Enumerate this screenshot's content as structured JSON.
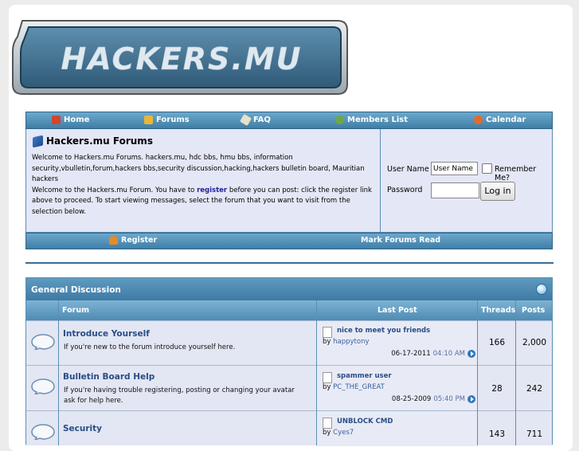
{
  "logo": {
    "text": "HACKERS.MU"
  },
  "nav": [
    {
      "label": "Home",
      "icon": "home-icon"
    },
    {
      "label": "Forums",
      "icon": "forums-icon"
    },
    {
      "label": "FAQ",
      "icon": "faq-icon"
    },
    {
      "label": "Members List",
      "icon": "members-icon"
    },
    {
      "label": "Calendar",
      "icon": "calendar-icon"
    }
  ],
  "welcome": {
    "title": "Hackers.mu Forums",
    "desc_1": "Welcome to Hackers.mu Forums. hackers.mu, hdc bbs, hmu bbs, information security,vbulletin,forum,hackers bbs,security discussion,hacking,hackers bulletin board, Mauritian hackers",
    "desc_2_pre": "Welcome to the Hackers.mu Forum. You have to ",
    "desc_2_link": "register",
    "desc_2_post": " before you can post: click the register link above to proceed. To start viewing messages, select the forum that you want to visit from the selection below."
  },
  "login": {
    "username_label": "User Name",
    "username_value": "User Name",
    "remember_label": "Remember Me?",
    "password_label": "Password",
    "password_value": "",
    "button": "Log in"
  },
  "subbar": {
    "register": "Register",
    "mark_read": "Mark Forums Read"
  },
  "category": {
    "title": "General Discussion",
    "columns": {
      "forum": "Forum",
      "last_post": "Last Post",
      "threads": "Threads",
      "posts": "Posts"
    },
    "forums": [
      {
        "title": "Introduce Yourself",
        "desc": "If you're new to the forum introduce yourself here.",
        "last_title": "nice to meet you friends",
        "by_prefix": "by ",
        "last_user": "happytony",
        "last_date": "06-17-2011",
        "last_time": "04:10 AM",
        "threads": "166",
        "posts": "2,000"
      },
      {
        "title": "Bulletin Board Help",
        "desc": "If you're having trouble registering, posting or changing your avatar ask for help here.",
        "last_title": "spammer user",
        "by_prefix": "by ",
        "last_user": "PC_THE_GREAT",
        "last_date": "08-25-2009",
        "last_time": "05:40 PM",
        "threads": "28",
        "posts": "242"
      },
      {
        "title": "Security",
        "desc": "",
        "last_title": "UNBLOCK CMD",
        "by_prefix": "by ",
        "last_user": "Cyes7",
        "last_date": "",
        "last_time": "",
        "threads": "143",
        "posts": "711"
      }
    ]
  }
}
